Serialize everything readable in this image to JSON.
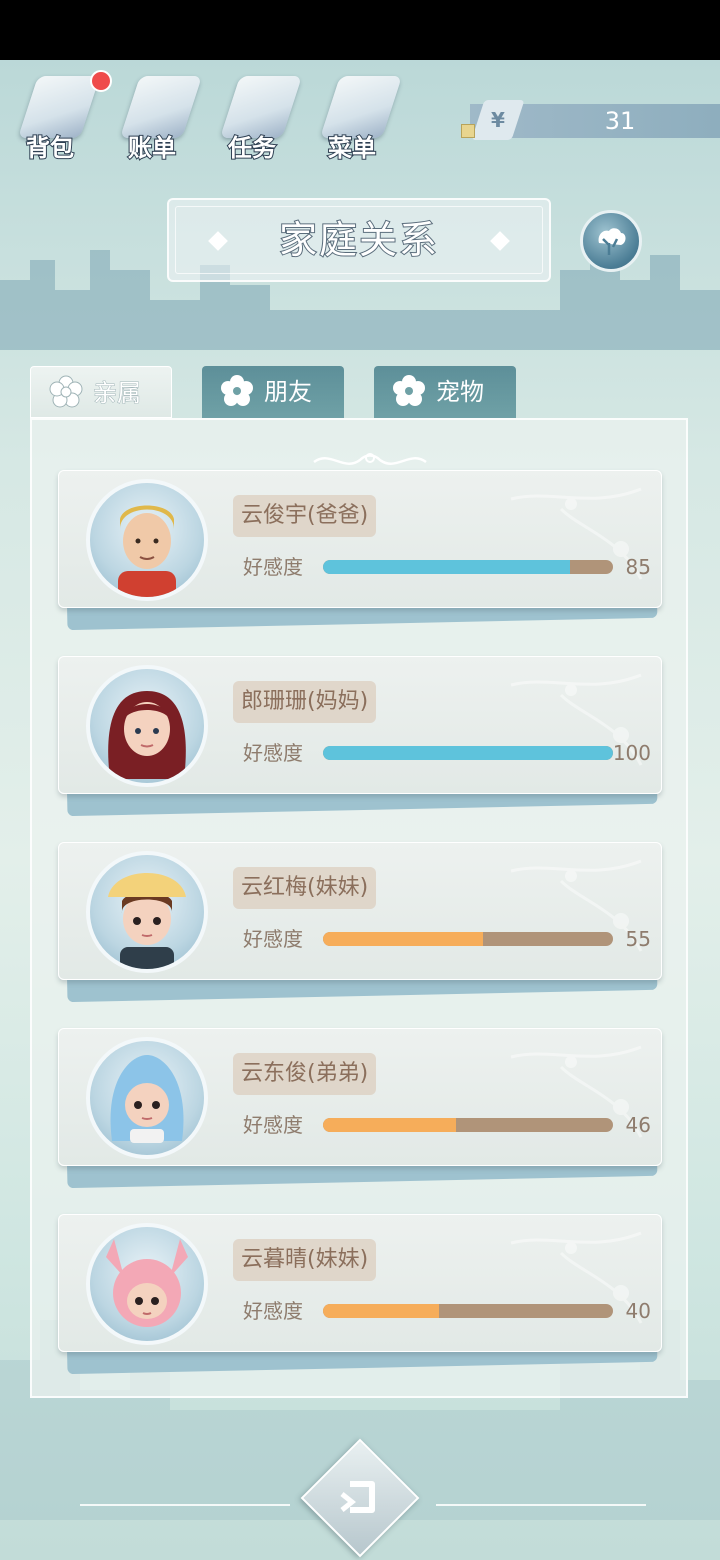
{
  "header": {
    "menu": [
      {
        "label": "背包",
        "icon": "backpack-icon"
      },
      {
        "label": "账单",
        "icon": "bill-icon"
      },
      {
        "label": "任务",
        "icon": "task-icon"
      },
      {
        "label": "菜单",
        "icon": "menu-icon"
      }
    ],
    "currency_symbol": "¥",
    "money": "31"
  },
  "title": "家庭关系",
  "tabs": [
    {
      "label": "亲属",
      "active": true
    },
    {
      "label": "朋友",
      "active": false
    },
    {
      "label": "宠物",
      "active": false
    }
  ],
  "favor_label": "好感度",
  "relatives": [
    {
      "name": "云俊宇(爸爸)",
      "favor": 85,
      "favor_text": "85",
      "bar_color": "#5ec3dc",
      "avatar": "dad-avatar"
    },
    {
      "name": "郎珊珊(妈妈)",
      "favor": 100,
      "favor_text": "100",
      "bar_color": "#5ec3dc",
      "avatar": "mom-avatar"
    },
    {
      "name": "云红梅(妹妹)",
      "favor": 55,
      "favor_text": "55",
      "bar_color": "#f6ad5a",
      "avatar": "sister-avatar"
    },
    {
      "name": "云东俊(弟弟)",
      "favor": 46,
      "favor_text": "46",
      "bar_color": "#f6ad5a",
      "avatar": "brother-avatar"
    },
    {
      "name": "云暮晴(妹妹)",
      "favor": 40,
      "favor_text": "40",
      "bar_color": "#f6ad5a",
      "avatar": "sister2-avatar"
    }
  ]
}
